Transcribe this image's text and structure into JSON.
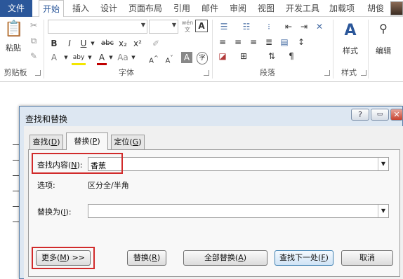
{
  "ribbon": {
    "tabs": [
      "文件",
      "开始",
      "插入",
      "设计",
      "页面布局",
      "引用",
      "邮件",
      "审阅",
      "视图",
      "开发工具",
      "加载项",
      "胡俊"
    ],
    "active_tab": "开始",
    "clipboard": {
      "paste_label": "粘贴",
      "group_label": "剪贴板"
    },
    "font": {
      "group_label": "字体",
      "font_name": "",
      "font_size": "",
      "wen_glyph": "wén",
      "bold": "B",
      "italic": "I",
      "underline": "U",
      "strike": "abc",
      "subscript": "x₂",
      "superscript": "x²",
      "grow": "A^",
      "shrink": "A˅",
      "case": "Aa",
      "clear": "A",
      "char_shade": "A",
      "enclose": "字",
      "highlight": "aby",
      "color": "A"
    },
    "paragraph": {
      "group_label": "段落"
    },
    "styles": {
      "label": "样式",
      "group_label": "样式"
    },
    "editing": {
      "label": "编辑"
    }
  },
  "dialog": {
    "title": "查找和替换",
    "help_btn": "?",
    "min_btn": "▭",
    "close_btn": "✕",
    "tabs": [
      {
        "text": "查找(",
        "key": "D",
        "end": ")"
      },
      {
        "text": "替换(",
        "key": "P",
        "end": ")"
      },
      {
        "text": "定位(",
        "key": "G",
        "end": ")"
      }
    ],
    "find": {
      "label": "查找内容(",
      "key": "N",
      "end": "):",
      "value": "香蕉"
    },
    "options": {
      "label": "选项:",
      "value": "区分全/半角"
    },
    "replace": {
      "label": "替换为(",
      "key": "I",
      "end": "):",
      "value": ""
    },
    "buttons": {
      "more": {
        "text": "更多(",
        "key": "M",
        "end": ") >>"
      },
      "replace": {
        "text": "替换(",
        "key": "R",
        "end": ")"
      },
      "replace_all": {
        "text": "全部替换(",
        "key": "A",
        "end": ")"
      },
      "find_next": {
        "text": "查找下一处(",
        "key": "F",
        "end": ")"
      },
      "cancel": "取消"
    },
    "highlight_color": "#d12b2b"
  }
}
